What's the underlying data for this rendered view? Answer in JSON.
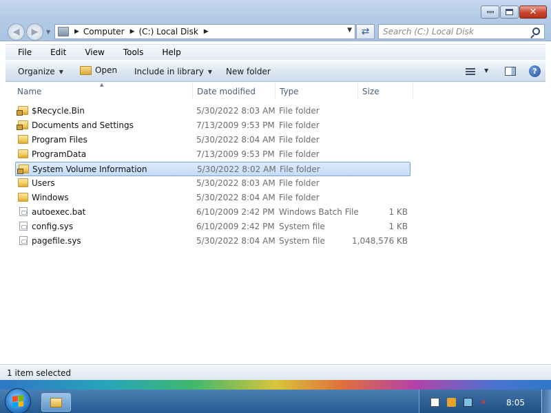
{
  "window": {
    "title_buttons": {
      "minimize_icon": "minimize-icon",
      "maximize_icon": "maximize-icon",
      "close_icon": "close-icon"
    }
  },
  "navigation": {
    "back_icon": "back-arrow-icon",
    "forward_icon": "forward-arrow-icon"
  },
  "address_bar": {
    "crumbs": [
      "Computer",
      "(C:) Local Disk"
    ]
  },
  "search": {
    "placeholder": "Search (C:) Local Disk"
  },
  "menu": {
    "items": [
      "File",
      "Edit",
      "View",
      "Tools",
      "Help"
    ]
  },
  "toolbar": {
    "organize": "Organize",
    "open": "Open",
    "include_in_library": "Include in library",
    "new_folder": "New folder"
  },
  "columns": {
    "name": "Name",
    "date_modified": "Date modified",
    "type": "Type",
    "size": "Size"
  },
  "files": [
    {
      "name": "$Recycle.Bin",
      "date": "5/30/2022 8:03 AM",
      "type": "File folder",
      "size": "",
      "icon": "locked-folder-icon"
    },
    {
      "name": "Documents and Settings",
      "date": "7/13/2009 9:53 PM",
      "type": "File folder",
      "size": "",
      "icon": "locked-folder-icon"
    },
    {
      "name": "Program Files",
      "date": "5/30/2022 8:04 AM",
      "type": "File folder",
      "size": "",
      "icon": "folder-icon"
    },
    {
      "name": "ProgramData",
      "date": "7/13/2009 9:53 PM",
      "type": "File folder",
      "size": "",
      "icon": "folder-icon"
    },
    {
      "name": "System Volume Information",
      "date": "5/30/2022 8:02 AM",
      "type": "File folder",
      "size": "",
      "icon": "locked-folder-icon",
      "selected": true
    },
    {
      "name": "Users",
      "date": "5/30/2022 8:03 AM",
      "type": "File folder",
      "size": "",
      "icon": "folder-icon"
    },
    {
      "name": "Windows",
      "date": "5/30/2022 8:04 AM",
      "type": "File folder",
      "size": "",
      "icon": "folder-icon"
    },
    {
      "name": "autoexec.bat",
      "date": "6/10/2009 2:42 PM",
      "type": "Windows Batch File",
      "size": "1 KB",
      "icon": "file-icon"
    },
    {
      "name": "config.sys",
      "date": "6/10/2009 2:42 PM",
      "type": "System file",
      "size": "1 KB",
      "icon": "file-icon"
    },
    {
      "name": "pagefile.sys",
      "date": "5/30/2022 8:04 AM",
      "type": "System file",
      "size": "1,048,576 KB",
      "icon": "file-icon"
    }
  ],
  "status": {
    "text": "1 item selected"
  },
  "taskbar": {
    "clock": "8:05",
    "colors": {
      "selection": "#cce4f7",
      "taskbar": "#245a91"
    }
  }
}
